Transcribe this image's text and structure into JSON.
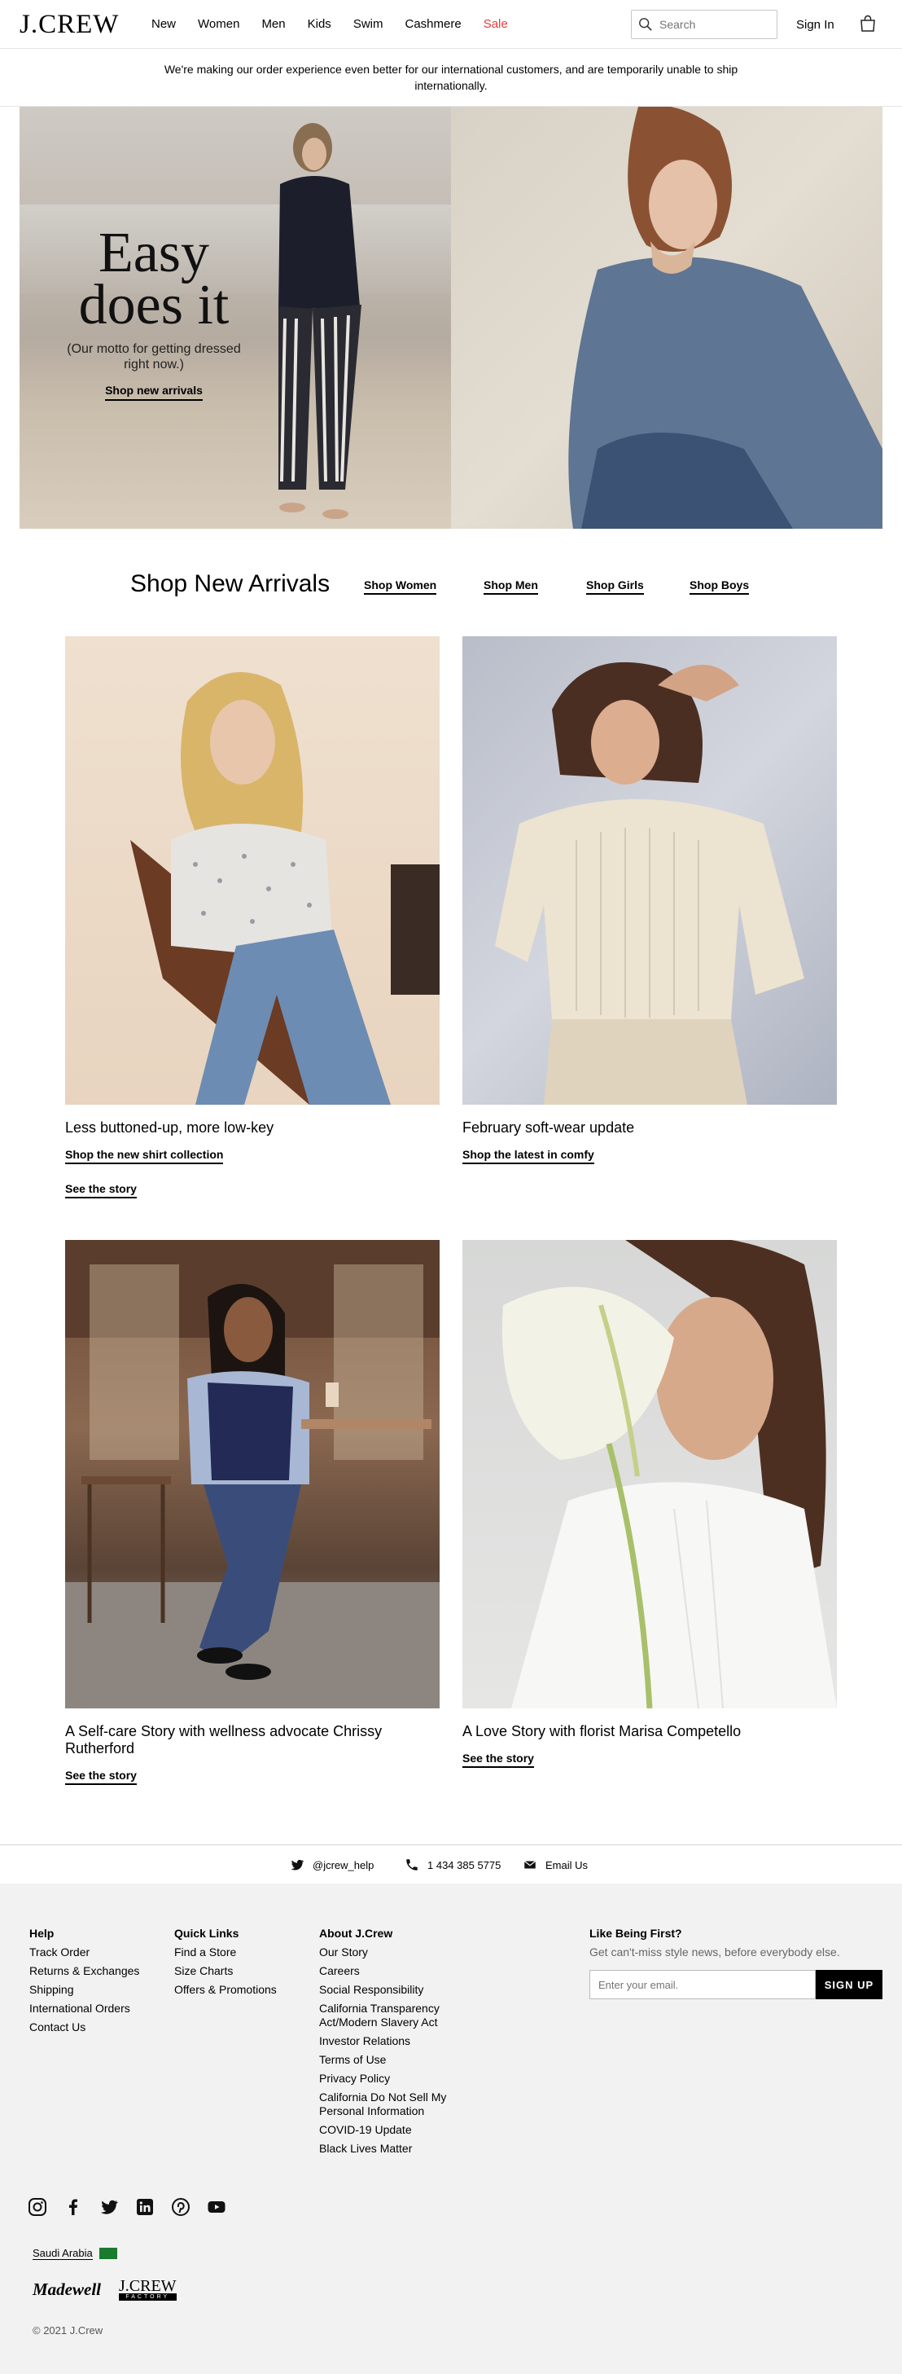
{
  "header": {
    "logo": "J.CREW",
    "nav": [
      "New",
      "Women",
      "Men",
      "Kids",
      "Swim",
      "Cashmere",
      "Sale"
    ],
    "search_placeholder": "Search",
    "sign_in": "Sign In"
  },
  "banner": {
    "text": "We're making our order experience even better for our international customers, and are temporarily unable to ship internationally."
  },
  "hero": {
    "title_line1": "Easy",
    "title_line2": "does it",
    "subtitle": "(Our motto for getting dressed right now.)",
    "cta": "Shop new arrivals"
  },
  "arrivals": {
    "title": "Shop New Arrivals",
    "links": [
      "Shop Women",
      "Shop Men",
      "Shop Girls",
      "Shop Boys"
    ]
  },
  "cards": [
    {
      "title": "Less buttoned-up, more low-key",
      "link": "Shop the new shirt collection",
      "link2": "See the story"
    },
    {
      "title": "February soft-wear update",
      "link": "Shop the latest in comfy"
    },
    {
      "title": "A Self-care Story with wellness advocate Chrissy Rutherford",
      "link": "See the story"
    },
    {
      "title": "A Love Story with florist Marisa Competello",
      "link": "See the story"
    }
  ],
  "contact": {
    "twitter": "@jcrew_help",
    "phone": "1 434 385 5775",
    "email": "Email Us"
  },
  "footer": {
    "help": {
      "heading": "Help",
      "items": [
        "Track Order",
        "Returns & Exchanges",
        "Shipping",
        "International Orders",
        "Contact Us"
      ]
    },
    "quick": {
      "heading": "Quick Links",
      "items": [
        "Find a Store",
        "Size Charts",
        "Offers & Promotions"
      ]
    },
    "about": {
      "heading": "About J.Crew",
      "items": [
        "Our Story",
        "Careers",
        "Social Responsibility",
        "California Transparency Act/Modern Slavery Act",
        "Investor Relations",
        "Terms of Use",
        "Privacy Policy",
        "California Do Not Sell My Personal Information",
        "COVID-19 Update",
        "Black Lives Matter"
      ]
    },
    "join": {
      "heading": "Like Being First?",
      "text": "Get can't-miss style news, before everybody else.",
      "placeholder": "Enter your email.",
      "button": "SIGN UP"
    },
    "country": "Saudi Arabia",
    "brand1": "Madewell",
    "brand2": "J.CREW",
    "brand2_sub": "FACTORY",
    "copyright": "© 2021 J.Crew"
  }
}
